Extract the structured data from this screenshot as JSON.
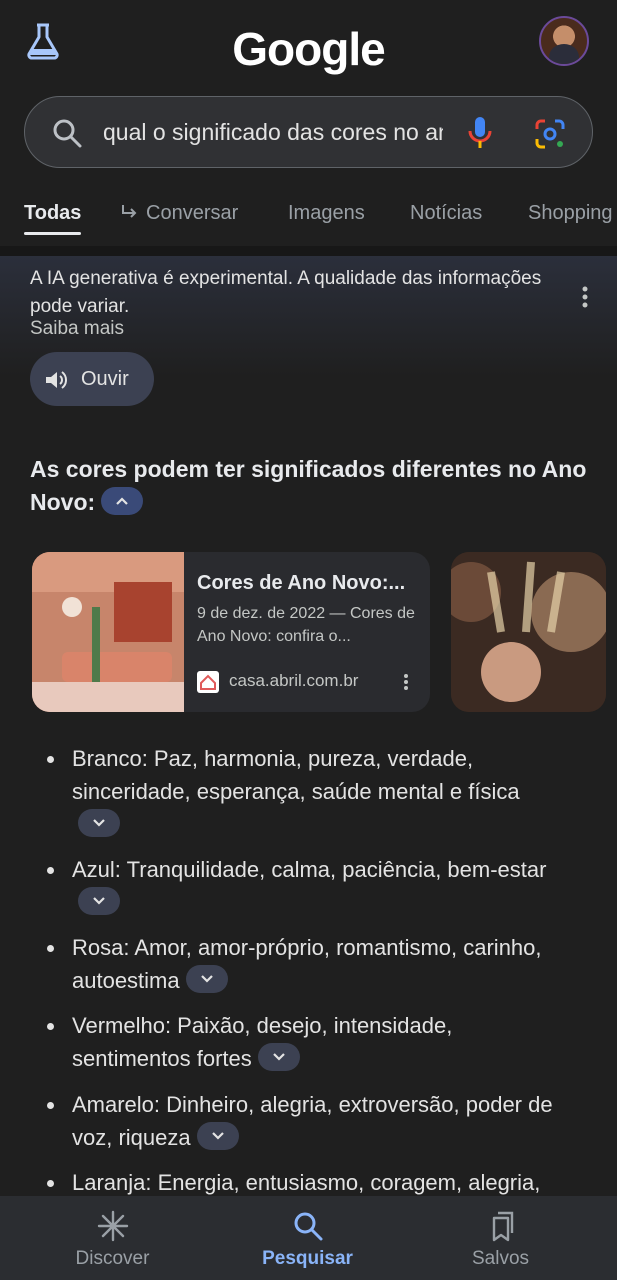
{
  "header": {
    "logo_text": "Google",
    "labs_icon": "beaker-icon",
    "avatar_icon": "user-avatar"
  },
  "search": {
    "query": "qual o significado das cores no ano novo",
    "icons": [
      "search-icon",
      "microphone-icon",
      "google-lens-icon"
    ]
  },
  "tabs": [
    {
      "label": "Todas",
      "active": true
    },
    {
      "label": "Conversar",
      "icon": "reply-arrow-icon"
    },
    {
      "label": "Imagens"
    },
    {
      "label": "Notícias"
    },
    {
      "label": "Shopping"
    }
  ],
  "ai_overview": {
    "notice": "A IA generativa é experimental. A qualidade das informações pode variar.",
    "learn_more": "Saiba mais",
    "listen_label": "Ouvir",
    "heading": "As cores podem ter significados diferentes no Ano Novo:"
  },
  "source_card": {
    "title": "Cores de Ano Novo:...",
    "snippet": "9 de dez. de 2022 — Cores de Ano Novo: confira o...",
    "site": "casa.abril.com.br"
  },
  "bullets": [
    "Branco: Paz, harmonia, pureza, verdade, sinceridade, esperança, saúde mental e física",
    "Azul: Tranquilidade, calma, paciência, bem-estar",
    "Rosa: Amor, amor-próprio, romantismo, carinho, autoestima",
    "Vermelho: Paixão, desejo, intensidade, sentimentos fortes",
    "Amarelo: Dinheiro, alegria, extroversão, poder de voz, riqueza",
    "Laranja: Energia, entusiasmo, coragem, alegria,"
  ],
  "bottom_nav": [
    {
      "label": "Discover",
      "icon": "sparkle-icon"
    },
    {
      "label": "Pesquisar",
      "icon": "search-icon",
      "active": true
    },
    {
      "label": "Salvos",
      "icon": "bookmarks-icon"
    }
  ],
  "colors": {
    "accent": "#8ab4f8",
    "background": "#1f1f1f"
  }
}
